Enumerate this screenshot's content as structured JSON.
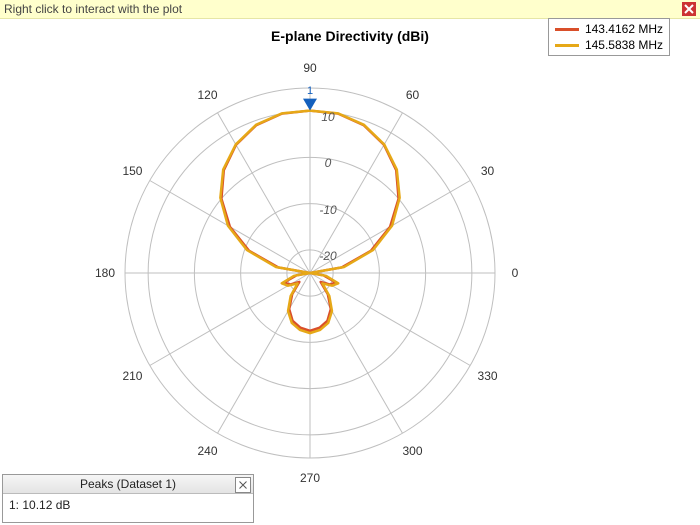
{
  "info_bar": {
    "text": "Right click to interact with the plot"
  },
  "title": "E-plane Directivity (dBi)",
  "legend": {
    "items": [
      {
        "label": "143.4162 MHz",
        "color": "#d94f2a"
      },
      {
        "label": "145.5838 MHz",
        "color": "#e6a817"
      }
    ]
  },
  "axis": {
    "angles": [
      0,
      30,
      60,
      90,
      120,
      150,
      180,
      210,
      240,
      270,
      300,
      330
    ],
    "rings": [
      {
        "value": -20,
        "label": "-20"
      },
      {
        "value": -10,
        "label": "-10"
      },
      {
        "value": 0,
        "label": "0"
      },
      {
        "value": 10,
        "label": "10"
      }
    ],
    "r_min": -25,
    "r_max": 15
  },
  "marker": {
    "id": "1",
    "angle": 90,
    "value": 10.12
  },
  "peaks_panel": {
    "title": "Peaks (Dataset 1)",
    "rows": [
      "1: 10.12 dB"
    ]
  },
  "chart_data": {
    "type": "polar-line",
    "title": "E-plane Directivity (dBi)",
    "angle_unit": "deg",
    "r_unit": "dBi",
    "r_range": [
      -25,
      15
    ],
    "angle_zero": "east",
    "angle_direction": "ccw",
    "series": [
      {
        "name": "143.4162 MHz",
        "color": "#d94f2a",
        "theta": [
          0,
          10,
          20,
          30,
          40,
          50,
          60,
          70,
          80,
          90,
          100,
          110,
          120,
          130,
          140,
          150,
          160,
          170,
          180,
          190,
          200,
          210,
          220,
          230,
          240,
          250,
          260,
          270,
          280,
          290,
          300,
          310,
          320,
          330,
          340,
          350
        ],
        "r": [
          -25,
          -18,
          -11,
          -5,
          0,
          4,
          7,
          9,
          10,
          10.12,
          10,
          9,
          7,
          4,
          0,
          -5,
          -11,
          -18,
          -25,
          -22,
          -19,
          -20,
          -22,
          -19,
          -16,
          -14,
          -13,
          -12.5,
          -13,
          -14,
          -16,
          -19,
          -22,
          -20,
          -19,
          -22
        ]
      },
      {
        "name": "145.5838 MHz",
        "color": "#e6a817",
        "theta": [
          0,
          10,
          20,
          30,
          40,
          50,
          60,
          70,
          80,
          90,
          100,
          110,
          120,
          130,
          140,
          150,
          160,
          170,
          180,
          190,
          200,
          210,
          220,
          230,
          240,
          250,
          260,
          270,
          280,
          290,
          300,
          310,
          320,
          330,
          340,
          350
        ],
        "r": [
          -25,
          -17.5,
          -10.5,
          -4.5,
          0.3,
          4.2,
          7.1,
          9.1,
          10.05,
          10.12,
          10.05,
          9.1,
          7.1,
          4.2,
          0.3,
          -4.5,
          -10.5,
          -17.5,
          -25,
          -21.5,
          -18.5,
          -19.5,
          -21.5,
          -18.5,
          -15.5,
          -13.5,
          -12.5,
          -12,
          -12.5,
          -13.5,
          -15.5,
          -18.5,
          -21.5,
          -19.5,
          -18.5,
          -21.5
        ]
      }
    ],
    "markers": [
      {
        "series": 0,
        "theta": 90,
        "r": 10.12,
        "label": "1"
      }
    ]
  }
}
